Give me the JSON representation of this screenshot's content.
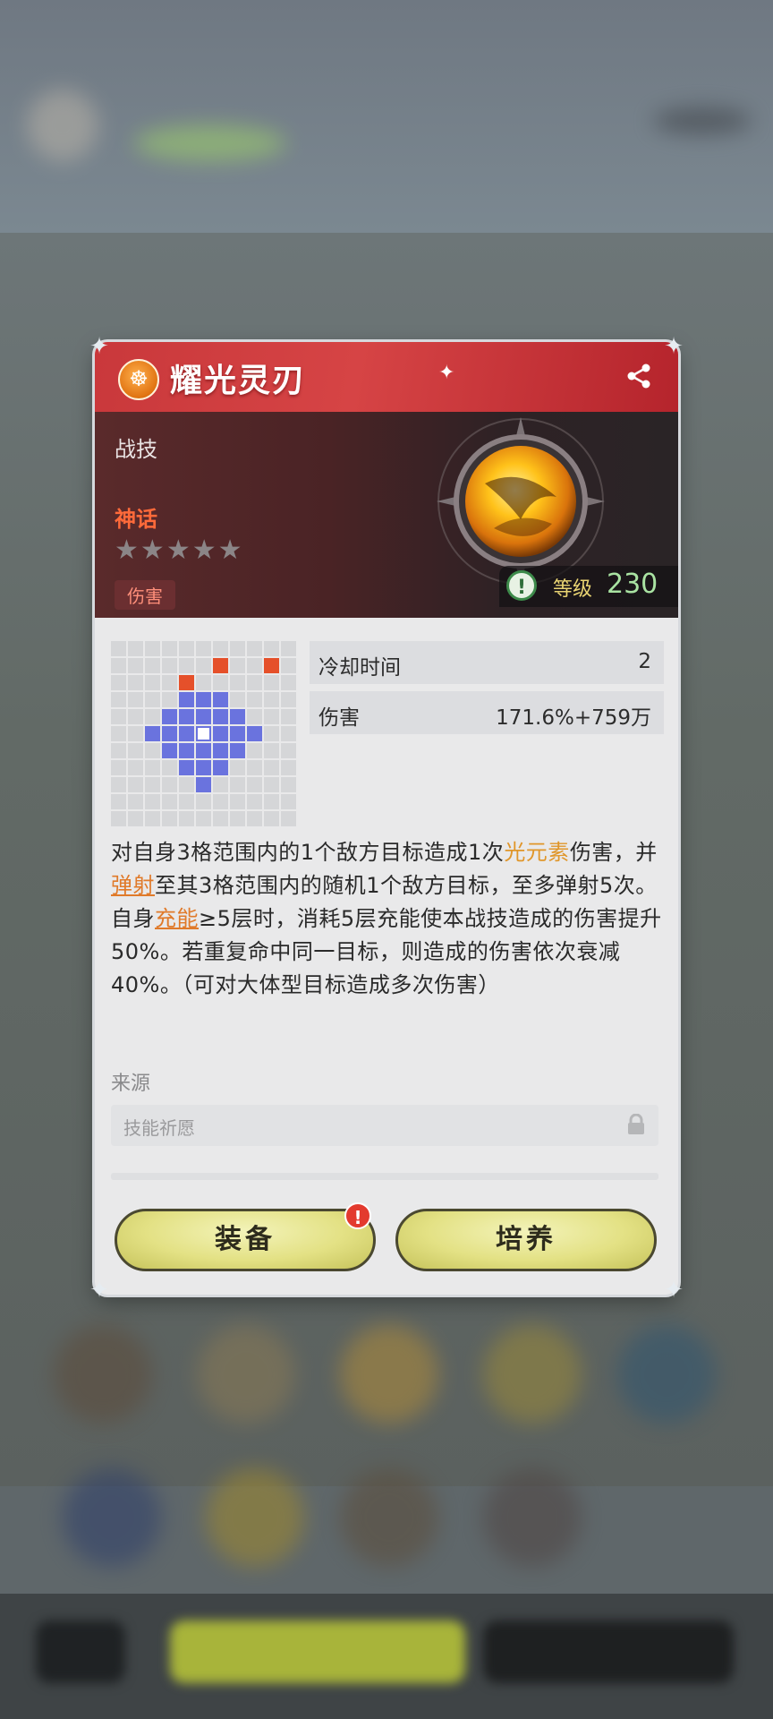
{
  "skill": {
    "name": "耀光灵刃",
    "type": "战技",
    "rarity": "神话",
    "tag": "伤害",
    "stars_filled": 0,
    "stars_total": 5,
    "level_label": "等级",
    "level_value": "230"
  },
  "stats": [
    {
      "label": "冷却时间",
      "value": "2"
    },
    {
      "label": "伤害",
      "value": "171.6%+759万"
    }
  ],
  "description": {
    "p1": "对自身3格范围内的1个敌方目标造成1次",
    "element": "光元素",
    "p2": "伤害，并",
    "bounce": "弹射",
    "p3": "至其3格范围内的随机1个敌方目标，至多弹射5次。自身",
    "charge": "充能",
    "p4": "≥5层时，消耗5层充能使本战技造成的伤害提升50%。若重复命中同一目标，则造成的伤害依次衰减40%。（可对大体型目标造成多次伤害）"
  },
  "source": {
    "label": "来源",
    "value": "技能祈愿"
  },
  "buttons": {
    "equip": "装备",
    "train": "培养",
    "alert": "!"
  },
  "icons": {
    "title_badge": "mask-icon",
    "share": "share-icon",
    "info": "info-icon",
    "lock": "lock-icon"
  },
  "colors": {
    "title_red": "#d64445",
    "rarity": "#ff6a3a",
    "range_blue": "#6a73de",
    "range_red": "#e5502a",
    "button": "#e3e184",
    "level_value": "#a9e3a2"
  }
}
